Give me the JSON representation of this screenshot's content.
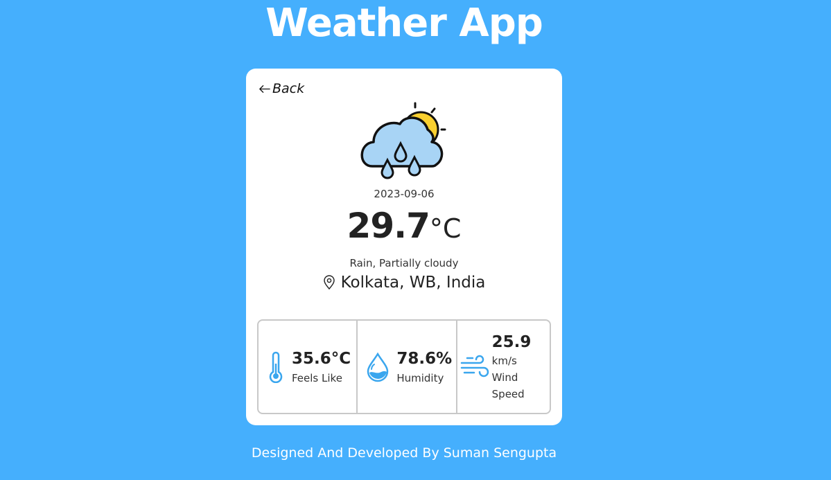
{
  "app": {
    "title": "Weather App"
  },
  "card": {
    "back_label": "Back",
    "date": "2023-09-06",
    "temperature": "29.7",
    "temperature_unit": "°C",
    "condition": "Rain, Partially cloudy",
    "location": "Kolkata, WB, India",
    "weather_icon": "rain-cloud-sun-icon"
  },
  "stats": {
    "feels_like": {
      "value": "35.6°C",
      "label": "Feels Like",
      "icon": "thermometer-icon"
    },
    "humidity": {
      "value": "78.6%",
      "label": "Humidity",
      "icon": "water-drop-icon"
    },
    "wind": {
      "value": "25.9",
      "unit": "km/s",
      "label_line1": "Wind",
      "label_line2": "Speed",
      "icon": "wind-icon"
    }
  },
  "footer": {
    "text": "Designed And Developed By Suman Sengupta"
  },
  "colors": {
    "background": "#45affd",
    "card": "#ffffff",
    "accent": "#3aa6ee",
    "sun": "#f9d030",
    "cloud": "#a8d4f5"
  }
}
